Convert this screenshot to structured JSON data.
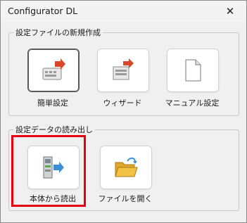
{
  "window": {
    "title": "Configurator DL",
    "close_glyph": "✕"
  },
  "new_config_group": {
    "label": "設定ファイルの新規作成",
    "items": [
      {
        "label": "簡単設定",
        "icon": "keyboard-arrow-icon"
      },
      {
        "label": "ウィザード",
        "icon": "wizard-icon"
      },
      {
        "label": "マニュアル設定",
        "icon": "document-icon"
      }
    ]
  },
  "read_settings_group": {
    "label": "設定データの読み出し",
    "items": [
      {
        "label": "本体から読出",
        "icon": "device-read-icon"
      },
      {
        "label": "ファイルを開く",
        "icon": "folder-open-icon"
      }
    ]
  },
  "colors": {
    "highlight": "#e60012",
    "arrow_red": "#d9472b",
    "arrow_blue": "#3c8fd6",
    "folder": "#f3c244"
  }
}
